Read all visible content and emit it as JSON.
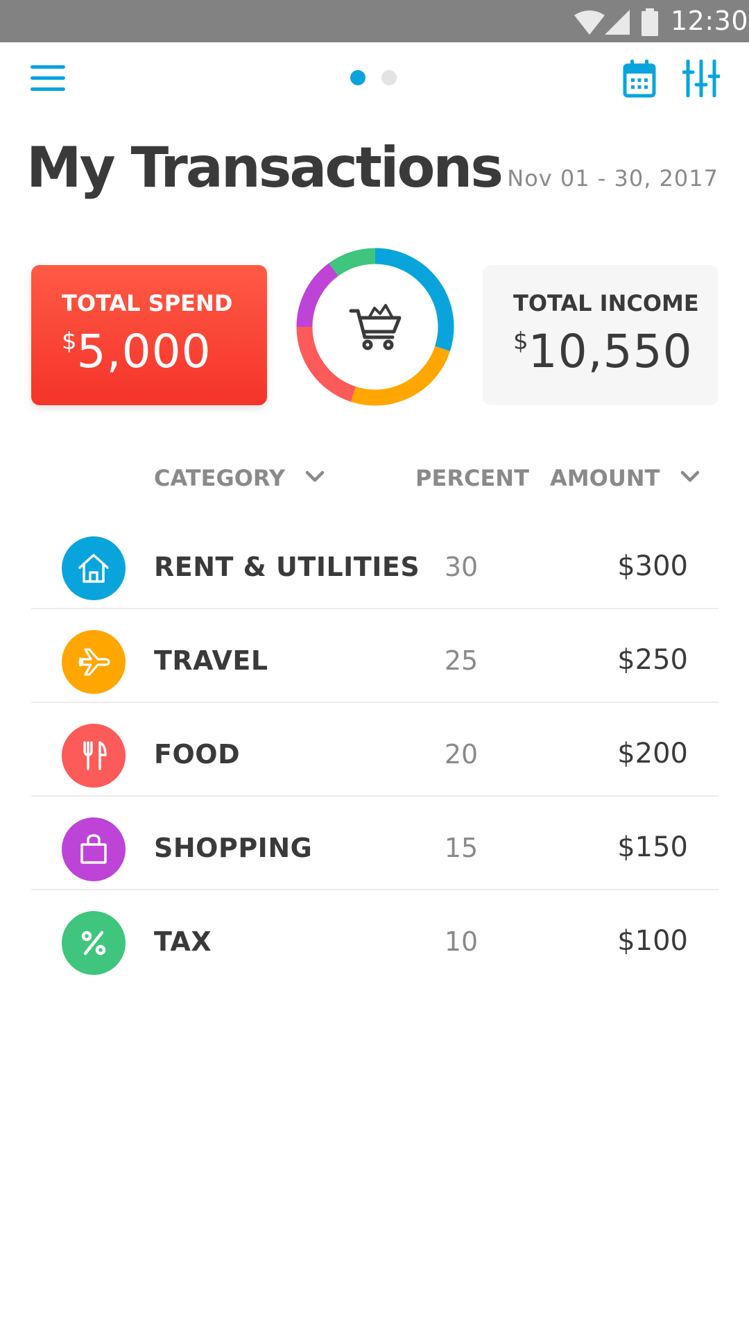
{
  "status_bar": {
    "time": "12:30"
  },
  "header": {
    "title": "My Transactions",
    "date_range": "Nov 01 - 30, 2017",
    "page_count": 2,
    "active_page": 1
  },
  "summary": {
    "spend_label": "TOTAL SPEND",
    "spend_currency": "$",
    "spend_amount": "5,000",
    "income_label": "TOTAL INCOME",
    "income_currency": "$",
    "income_amount": "10,550"
  },
  "table": {
    "headers": {
      "category": "CATEGORY",
      "percent": "PERCENT",
      "amount": "AMOUNT"
    },
    "rows": [
      {
        "name": "RENT & UTILITIES",
        "percent": "30",
        "amount": "$300",
        "icon": "house-icon",
        "color": "#0aa4dd"
      },
      {
        "name": "TRAVEL",
        "percent": "25",
        "amount": "$250",
        "icon": "airplane-icon",
        "color": "#ffa600"
      },
      {
        "name": "FOOD",
        "percent": "20",
        "amount": "$200",
        "icon": "fork-knife-icon",
        "color": "#fd5a5a"
      },
      {
        "name": "SHOPPING",
        "percent": "15",
        "amount": "$150",
        "icon": "shopping-bag-icon",
        "color": "#bd44d6"
      },
      {
        "name": "TAX",
        "percent": "10",
        "amount": "$100",
        "icon": "percent-icon",
        "color": "#3fc57d"
      }
    ]
  },
  "donut": {
    "center_icon": "shopping-cart-icon",
    "segments": [
      {
        "value": 30,
        "color": "#0aa4dd"
      },
      {
        "value": 25,
        "color": "#ffa600"
      },
      {
        "value": 20,
        "color": "#fd5a5a"
      },
      {
        "value": 15,
        "color": "#bd44d6"
      },
      {
        "value": 10,
        "color": "#3fc57d"
      }
    ]
  },
  "colors": {
    "accent": "#0aa4dd",
    "spend_card": "#f5332a"
  }
}
